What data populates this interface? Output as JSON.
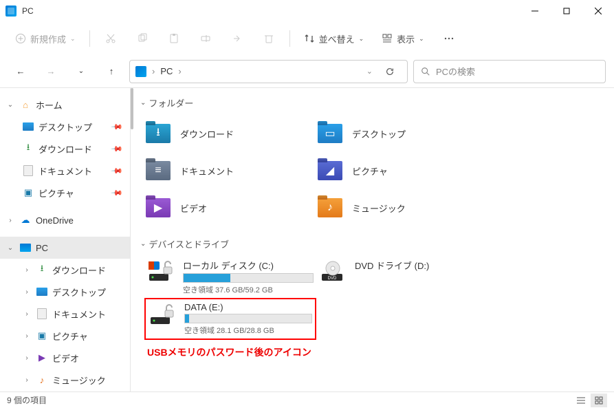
{
  "window": {
    "title": "PC"
  },
  "toolbar": {
    "new_label": "新規作成",
    "sort_label": "並べ替え",
    "view_label": "表示"
  },
  "address": {
    "crumb_pc": "PC",
    "crumb_sep": "›"
  },
  "search": {
    "placeholder": "PCの検索"
  },
  "sidebar": {
    "home": "ホーム",
    "desktop": "デスクトップ",
    "downloads": "ダウンロード",
    "documents": "ドキュメント",
    "pictures": "ピクチャ",
    "onedrive": "OneDrive",
    "pc": "PC",
    "pc_downloads": "ダウンロード",
    "pc_desktop": "デスクトップ",
    "pc_documents": "ドキュメント",
    "pc_pictures": "ピクチャ",
    "pc_videos": "ビデオ",
    "pc_music": "ミュージック"
  },
  "groups": {
    "folders": "フォルダー",
    "devices": "デバイスとドライブ"
  },
  "folders": {
    "downloads": "ダウンロード",
    "desktop": "デスクトップ",
    "documents": "ドキュメント",
    "pictures": "ピクチャ",
    "videos": "ビデオ",
    "music": "ミュージック"
  },
  "drives": {
    "c_name": "ローカル ディスク (C:)",
    "c_free": "空き領域 37.6 GB/59.2 GB",
    "c_fill_pct": 36,
    "dvd_name": "DVD ドライブ (D:)",
    "e_name": "DATA (E:)",
    "e_free": "空き領域 28.1 GB/28.8 GB",
    "e_fill_pct": 3
  },
  "annotation": "USBメモリのパスワード後のアイコン",
  "status": {
    "count": "9 個の項目"
  }
}
